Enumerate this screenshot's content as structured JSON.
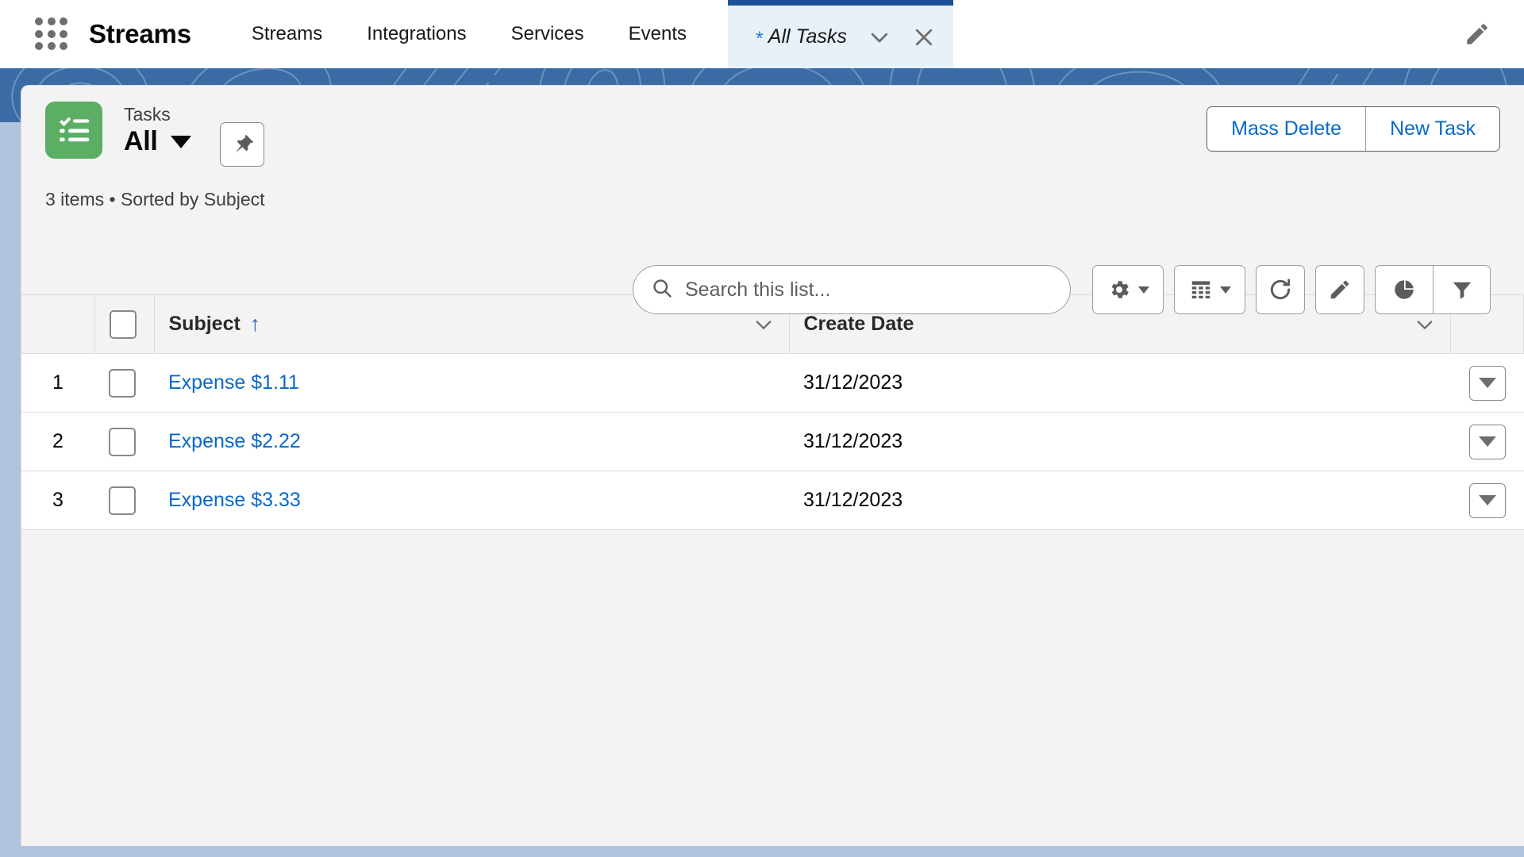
{
  "nav": {
    "app_launcher_icon": "app-launcher-grid-icon",
    "app_name": "Streams",
    "items": [
      {
        "label": "Streams"
      },
      {
        "label": "Integrations"
      },
      {
        "label": "Services"
      },
      {
        "label": "Events"
      }
    ],
    "edit_icon": "pencil-icon"
  },
  "tab": {
    "unsaved_marker": "*",
    "label": "All Tasks",
    "chevron_icon": "chevron-down-icon",
    "close_icon": "close-icon"
  },
  "list_header": {
    "object_icon": "task-checklist-icon",
    "object_type": "Tasks",
    "view_name": "All",
    "view_caret_icon": "caret-down-icon",
    "pin_icon": "pin-icon",
    "meta": "3 items • Sorted by Subject",
    "item_count": 3,
    "sorted_by": "Subject"
  },
  "actions": {
    "mass_delete": "Mass Delete",
    "new_task": "New Task"
  },
  "search": {
    "placeholder": "Search this list...",
    "value": "",
    "icon": "search-icon"
  },
  "tools": [
    {
      "name": "list-view-controls-button",
      "icon": "gear-icon",
      "has_caret": true
    },
    {
      "name": "display-as-button",
      "icon": "table-icon",
      "has_caret": true
    },
    {
      "name": "refresh-button",
      "icon": "refresh-icon",
      "has_caret": false
    },
    {
      "name": "edit-list-button",
      "icon": "pencil-icon",
      "has_caret": false
    },
    {
      "name": "charts-button",
      "icon": "pie-chart-icon",
      "has_caret": false
    },
    {
      "name": "filters-button",
      "icon": "filter-icon",
      "has_caret": false
    }
  ],
  "table": {
    "columns": [
      {
        "label": "Subject",
        "sorted": true,
        "sort_icon": "arrow-up-icon"
      },
      {
        "label": "Create Date",
        "sorted": false
      }
    ],
    "select_all_checkbox": false,
    "rows": [
      {
        "num": "1",
        "subject": "Expense $1.11",
        "create_date": "31/12/2023"
      },
      {
        "num": "2",
        "subject": "Expense $2.22",
        "create_date": "31/12/2023"
      },
      {
        "num": "3",
        "subject": "Expense $3.33",
        "create_date": "31/12/2023"
      }
    ]
  },
  "colors": {
    "brand_blue": "#0a68c8",
    "banner_blue": "#3a6ba5",
    "tab_accent": "#1b5297",
    "task_green": "#5bae63",
    "page_bg": "#f3f3f3"
  }
}
